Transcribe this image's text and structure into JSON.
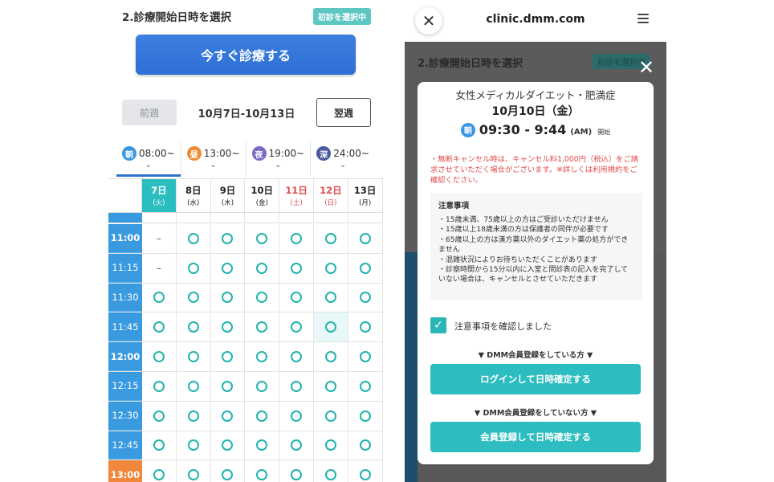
{
  "left": {
    "section_title": "2.診療開始日時を選択",
    "badge": "初診を選択中",
    "now_button": "今すぐ診療する",
    "prev_week": "前週",
    "week_range": "10月7日-10月13日",
    "next_week": "翌週",
    "time_tabs": [
      {
        "icon": "朝",
        "time": "08:00~",
        "color": "#3a96e0"
      },
      {
        "icon": "昼",
        "time": "13:00~",
        "color": "#ef8a35"
      },
      {
        "icon": "夜",
        "time": "19:00~",
        "color": "#7b6bc4"
      },
      {
        "icon": "深",
        "time": "24:00~",
        "color": "#4b5aa0"
      }
    ],
    "days": [
      {
        "date": "7日",
        "dow": "(火)"
      },
      {
        "date": "8日",
        "dow": "(水)"
      },
      {
        "date": "9日",
        "dow": "(木)"
      },
      {
        "date": "10日",
        "dow": "(金)"
      },
      {
        "date": "11日",
        "dow": "(土)"
      },
      {
        "date": "12日",
        "dow": "(日)"
      },
      {
        "date": "13日",
        "dow": "(月)"
      }
    ],
    "rows": [
      {
        "time": "11:00",
        "cells": [
          "–",
          "o",
          "o",
          "o",
          "o",
          "o",
          "o"
        ]
      },
      {
        "time": "11:15",
        "cells": [
          "–",
          "o",
          "o",
          "o",
          "o",
          "o",
          "o"
        ]
      },
      {
        "time": "11:30",
        "cells": [
          "o",
          "o",
          "o",
          "o",
          "o",
          "o",
          "o"
        ]
      },
      {
        "time": "11:45",
        "cells": [
          "o",
          "o",
          "o",
          "o",
          "o",
          "o",
          "o"
        ]
      },
      {
        "time": "12:00",
        "cells": [
          "o",
          "o",
          "o",
          "o",
          "o",
          "o",
          "o"
        ]
      },
      {
        "time": "12:15",
        "cells": [
          "o",
          "o",
          "o",
          "o",
          "o",
          "o",
          "o"
        ]
      },
      {
        "time": "12:30",
        "cells": [
          "o",
          "o",
          "o",
          "o",
          "o",
          "o",
          "o"
        ]
      },
      {
        "time": "12:45",
        "cells": [
          "o",
          "o",
          "o",
          "o",
          "o",
          "o",
          "o"
        ]
      },
      {
        "time": "13:00",
        "cells": [
          "o",
          "o",
          "o",
          "o",
          "o",
          "o",
          "o"
        ]
      }
    ],
    "colors": {
      "morning": "#3a9ae0",
      "afternoon": "#f0873a",
      "selected_day": "#2cbdc0",
      "weekend": "#e04c4c"
    }
  },
  "right": {
    "url": "clinic.dmm.com",
    "bg_title": "2.診療開始日時を選択",
    "bg_badge": "初診を選択中",
    "modal": {
      "title": "女性メディカルダイエット・肥満症",
      "date": "10月10日（金）",
      "period_icon": "朝",
      "time": "09:30 - 9:44",
      "ampm": "(AM)",
      "start_label": "開始",
      "warning": "・無断キャンセル時は、キャンセル料1,000円（税込）をご請求させていただく場合がございます。※詳しくは利用規約をご確認ください。",
      "notes_title": "注意事項",
      "notes": [
        "・15歳未満、75歳以上の方はご受診いただけません",
        "・15歳以上18歳未満の方は保護者の同伴が必要です",
        "・65歳以上の方は漢方薬以外のダイエット薬の処方ができません",
        "・混雑状況によりお待ちいただくことがあります",
        "・診察時間から15分以内に入室と問診表の記入を完了していない場合は、キャンセルとさせていただきます"
      ],
      "confirm_label": "注意事項を確認しました",
      "member_label": "▼ DMM会員登録をしている方 ▼",
      "login_button": "ログインして日時確定する",
      "nonmember_label": "▼ DMM会員登録をしていない方 ▼",
      "register_button": "会員登録して日時確定する"
    }
  }
}
